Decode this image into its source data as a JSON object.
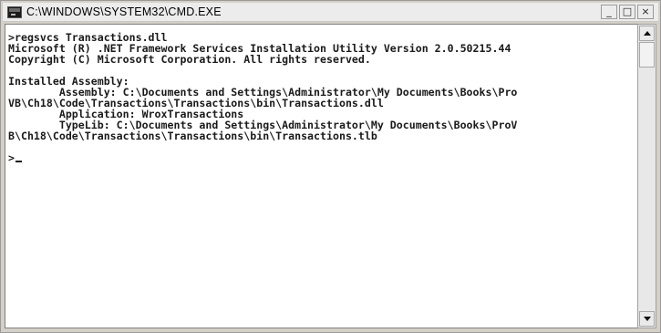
{
  "window": {
    "title": "C:\\WINDOWS\\SYSTEM32\\CMD.EXE",
    "app_icon": "cmd-console-icon",
    "controls": {
      "minimize": "_",
      "maximize": "□",
      "close": "×"
    }
  },
  "console": {
    "lines": [
      ">regsvcs Transactions.dll",
      "Microsoft (R) .NET Framework Services Installation Utility Version 2.0.50215.44",
      "Copyright (C) Microsoft Corporation. All rights reserved.",
      "",
      "Installed Assembly:",
      "        Assembly: C:\\Documents and Settings\\Administrator\\My Documents\\Books\\Pro",
      "VB\\Ch18\\Code\\Transactions\\Transactions\\bin\\Transactions.dll",
      "        Application: WroxTransactions",
      "        TypeLib: C:\\Documents and Settings\\Administrator\\My Documents\\Books\\ProV",
      "B\\Ch18\\Code\\Transactions\\Transactions\\bin\\Transactions.tlb",
      ""
    ],
    "prompt": ">"
  },
  "scrollbar": {
    "up_icon": "scroll-up-arrow-icon",
    "down_icon": "scroll-down-arrow-icon",
    "position": 0
  }
}
